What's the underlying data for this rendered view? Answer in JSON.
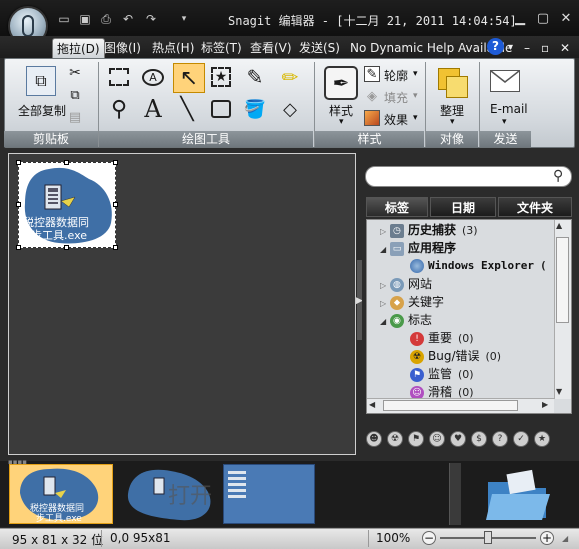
{
  "window": {
    "title": "Snagit 编辑器 - [十二月 21, 2011 14:04:54]"
  },
  "menu": {
    "items": [
      "拖拉(D)",
      "图像(I)",
      "热点(H)",
      "标签(T)",
      "查看(V)",
      "发送(S)"
    ],
    "help_text": "No Dynamic Help Available",
    "help_icon": "?"
  },
  "ribbon": {
    "clipboard": {
      "copy_all": "全部复制",
      "group": "剪贴板"
    },
    "drawing": {
      "group": "绘图工具"
    },
    "style": {
      "style_label": "样式",
      "outline": "轮廓",
      "fill": "填充",
      "effects": "效果",
      "group": "样式"
    },
    "object": {
      "arrange": "整理",
      "group": "对像"
    },
    "send": {
      "email": "E-mail",
      "group": "发送"
    }
  },
  "canvas": {
    "thumb_label_1": "税控器数据同",
    "thumb_label_2": "步工具.exe"
  },
  "tags": {
    "search_placeholder": "",
    "tabs": [
      "标签",
      "日期",
      "文件夹"
    ],
    "tree": [
      {
        "label": "历史捕获",
        "count": "(3)"
      },
      {
        "label": "应用程序",
        "count": ""
      },
      {
        "label": "Windows Explorer",
        "count": "("
      },
      {
        "label": "网站",
        "count": ""
      },
      {
        "label": "关键字",
        "count": ""
      },
      {
        "label": "标志",
        "count": ""
      },
      {
        "label": "重要",
        "count": "(0)"
      },
      {
        "label": "Bug/错误",
        "count": "(0)"
      },
      {
        "label": "监管",
        "count": "(0)"
      },
      {
        "label": "滑稽",
        "count": "(0)"
      }
    ]
  },
  "tray": {
    "watermark": "打开"
  },
  "status": {
    "dimensions": "95 x 81 x 32 位",
    "position": "0,0  95x81",
    "zoom": "100%"
  },
  "colors": {
    "accent": "#f5a623",
    "selection": "#ffd37a",
    "thumb_blue": "#3f6fa6"
  }
}
